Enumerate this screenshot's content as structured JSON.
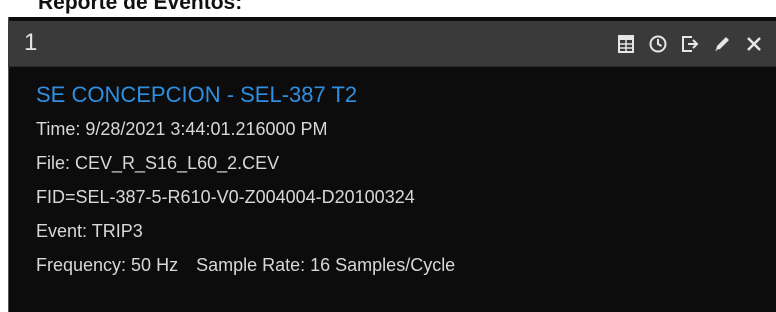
{
  "page": {
    "heading": "Reporte de Eventos:"
  },
  "panel": {
    "number": "1",
    "toolbar": {
      "icons": [
        "table-icon",
        "clock-icon",
        "export-icon",
        "edit-icon",
        "close-icon"
      ]
    },
    "title": "SE CONCEPCION - SEL-387 T2",
    "time": "Time:  9/28/2021 3:44:01.216000 PM",
    "file": "File: CEV_R_S16_L60_2.CEV",
    "fid": "FID=SEL-387-5-R610-V0-Z004004-D20100324",
    "event": "Event: TRIP3",
    "frequency": "Frequency: 50 Hz",
    "sample_rate": "Sample Rate: 16 Samples/Cycle"
  },
  "colors": {
    "title": "#2f8fe0",
    "header_bg": "#3a3a3a",
    "panel_bg": "#0c0c0c",
    "text": "#d8d8d8"
  }
}
